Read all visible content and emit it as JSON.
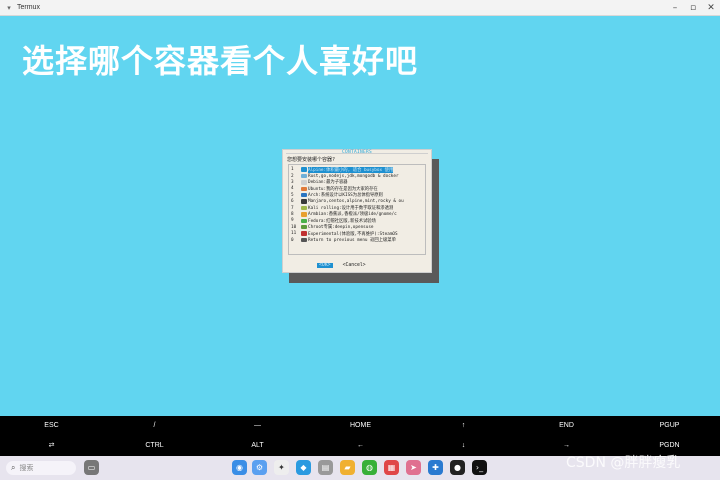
{
  "window": {
    "title": "Termux"
  },
  "overlay_text": "选择哪个容器看个人喜好吧",
  "dialog": {
    "title": "CONTAINERS",
    "prompt": "您想要安装哪个容器?",
    "items": [
      {
        "num": "1",
        "label": "Alpine:体积最小的, 适合 busybox 使用",
        "color": "#1e90d0"
      },
      {
        "num": "2",
        "label": "Rust,go,nodejs,jdk,mongodb & docker",
        "color": "#6fb0d8"
      },
      {
        "num": "3",
        "label": "Debian:最为子容器",
        "color": "#d0d0d0"
      },
      {
        "num": "4",
        "label": "Ubuntu:我的存在是因为大家的存在",
        "color": "#e07a3a"
      },
      {
        "num": "5",
        "label": "Arch:系统设计以KISS为总体指导原则",
        "color": "#2a74c0"
      },
      {
        "num": "6",
        "label": "Manjaro,centos,alpine,mint,rocky & ou",
        "color": "#3a3a3a"
      },
      {
        "num": "7",
        "label": "Kali rolling:设计用于数字取证和渗透测",
        "color": "#a0b84a"
      },
      {
        "num": "8",
        "label": "Armbian:香蕉派,香橙派/领极ide/gnome/c",
        "color": "#e8a030"
      },
      {
        "num": "9",
        "label": "Fedora:红帽社区版,新技术试验场",
        "color": "#48b048"
      },
      {
        "num": "10",
        "label": "Chroot专属:deepin,opensuse",
        "color": "#5a9a3a"
      },
      {
        "num": "11",
        "label": "Experimental(体验版,不再维护):SteamOS",
        "color": "#c03030"
      },
      {
        "num": "0",
        "label": "Return to previous menu 返回上级菜单",
        "color": "#555555"
      }
    ],
    "ok_label": "<OK>",
    "cancel_label": "<Cancel>"
  },
  "keys": {
    "row1": [
      "ESC",
      "/",
      "—",
      "HOME",
      "↑",
      "END",
      "PGUP"
    ],
    "row2": [
      "⇄",
      "CTRL",
      "ALT",
      "←",
      "↓",
      "→",
      "PGDN"
    ]
  },
  "taskbar": {
    "search_placeholder": "搜索",
    "search_icon": "search-icon"
  },
  "watermark": "CSDN @胖胖瘦乳"
}
